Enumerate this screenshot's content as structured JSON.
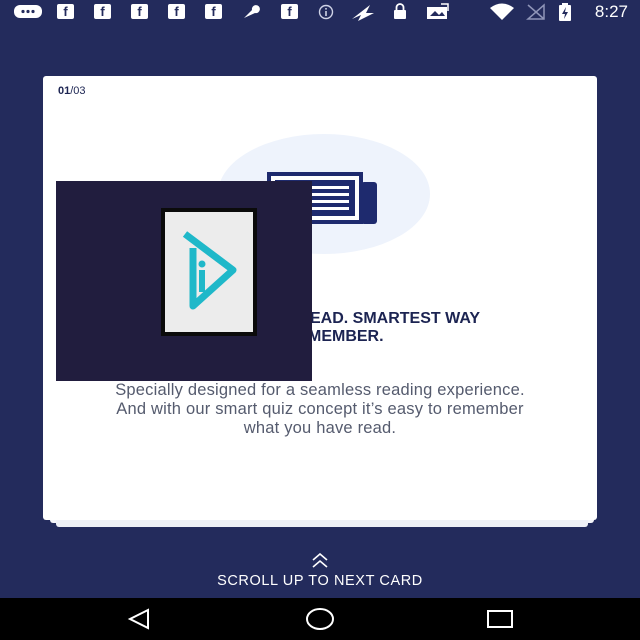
{
  "status_bar": {
    "time": "8:27",
    "icons": [
      "chat-icon",
      "facebook-icon",
      "facebook-icon",
      "facebook-icon",
      "facebook-icon",
      "facebook-icon",
      "wrench-icon",
      "facebook-icon",
      "info-icon",
      "fast-icon",
      "lock-icon",
      "photo-icon",
      "wifi-icon",
      "no-signal-icon",
      "battery-charging-icon"
    ],
    "fb_glyph": "f"
  },
  "card": {
    "counter_current": "01",
    "counter_total": "/03",
    "heading_line1": "EAD. SMARTEST WAY",
    "heading_line2": "MEMBER.",
    "description": "Specially designed for a seamless reading experience. And with our smart quiz concept it’s easy to remember what you have read.",
    "illustration_icon": "newspaper-icon",
    "overlay_icon": "app-logo-icon"
  },
  "scroll_hint": {
    "label": "SCROLL UP TO NEXT CARD",
    "icon": "double-chevron-up-icon"
  },
  "nav_bar": {
    "buttons": [
      "back-icon",
      "home-icon",
      "recents-icon"
    ]
  },
  "colors": {
    "background": "#232b5c",
    "card": "#ffffff",
    "heading": "#1c2452",
    "overlay": "#211d3e",
    "logo_accent": "#1fb8c9"
  }
}
